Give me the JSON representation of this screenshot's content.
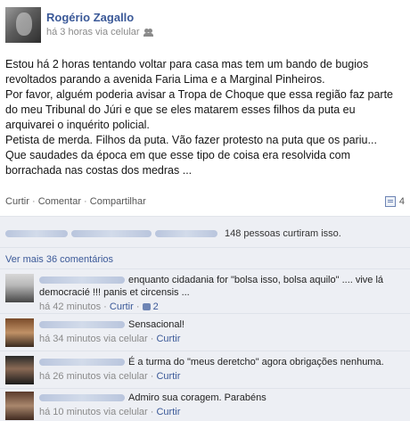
{
  "post": {
    "author": "Rogério Zagallo",
    "meta": "há 3 horas via celular",
    "paragraphs": [
      "Estou há 2 horas tentando voltar para casa mas tem um bando de bugios revoltados parando a avenida Faria Lima e a Marginal Pinheiros.",
      "Por favor, alguém poderia avisar a Tropa de Choque que essa região faz parte do meu Tribunal do Júri e que se eles matarem esses filhos da puta eu arquivarei o inquérito policial.",
      "Petista de merda. Filhos da puta. Vão fazer protesto na puta que os pariu...",
      "Que saudades da época em que esse tipo de coisa era resolvida com borrachada nas costas dos medras ..."
    ],
    "actions": {
      "like": "Curtir",
      "comment": "Comentar",
      "share": "Compartilhar",
      "separator": "·"
    },
    "comment_count": "4",
    "likes_text": "148 pessoas curtiram isso.",
    "more_comments": "Ver mais 36 comentários"
  },
  "comments": [
    {
      "text": "enquanto cidadania for \"bolsa isso, bolsa aquilo\" .... vive lá democracié !!! panis et circensis ...",
      "time": "há 42 minutos",
      "like": "Curtir",
      "likes": "2",
      "separator": "·"
    },
    {
      "text": "Sensacional!",
      "time": "há 34 minutos via celular",
      "like": "Curtir",
      "separator": "·"
    },
    {
      "text": "É a turma do \"meus deretcho\" agora obrigações nenhuma.",
      "time": "há 26 minutos via celular",
      "like": "Curtir",
      "separator": "·"
    },
    {
      "text": "Admiro sua coragem. Parabéns",
      "time": "há 10 minutos via celular",
      "like": "Curtir",
      "separator": "·"
    }
  ]
}
